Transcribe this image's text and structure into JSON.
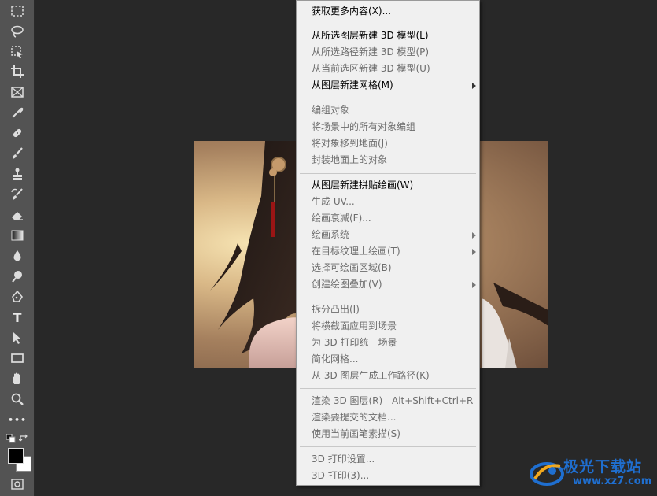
{
  "menu": {
    "items": [
      {
        "label": "获取更多内容(X)...",
        "enabled": true
      },
      {
        "label": "从所选图层新建 3D 模型(L)",
        "enabled": true
      },
      {
        "label": "从所选路径新建 3D 模型(P)",
        "enabled": false
      },
      {
        "label": "从当前选区新建 3D 模型(U)",
        "enabled": false
      },
      {
        "label": "从图层新建网格(M)",
        "enabled": true,
        "submenu": true
      },
      {
        "label": "编组对象",
        "enabled": false
      },
      {
        "label": "将场景中的所有对象编组",
        "enabled": false
      },
      {
        "label": "将对象移到地面(J)",
        "enabled": false
      },
      {
        "label": "封装地面上的对象",
        "enabled": false
      },
      {
        "label": "从图层新建拼贴绘画(W)",
        "enabled": true
      },
      {
        "label": "生成 UV...",
        "enabled": false
      },
      {
        "label": "绘画衰减(F)...",
        "enabled": false
      },
      {
        "label": "绘画系统",
        "enabled": false,
        "submenu": true
      },
      {
        "label": "在目标纹理上绘画(T)",
        "enabled": false,
        "submenu": true
      },
      {
        "label": "选择可绘画区域(B)",
        "enabled": false
      },
      {
        "label": "创建绘图叠加(V)",
        "enabled": false,
        "submenu": true
      },
      {
        "label": "拆分凸出(I)",
        "enabled": false
      },
      {
        "label": "将横截面应用到场景",
        "enabled": false
      },
      {
        "label": "为 3D 打印统一场景",
        "enabled": false
      },
      {
        "label": "简化网格...",
        "enabled": false
      },
      {
        "label": "从 3D 图层生成工作路径(K)",
        "enabled": false
      },
      {
        "label": "渲染 3D 图层(R)",
        "enabled": false,
        "shortcut": "Alt+Shift+Ctrl+R"
      },
      {
        "label": "渲染要提交的文档...",
        "enabled": false
      },
      {
        "label": "使用当前画笔素描(S)",
        "enabled": false
      },
      {
        "label": "3D 打印设置...",
        "enabled": false
      },
      {
        "label": "3D 打印(3)...",
        "enabled": false
      }
    ]
  },
  "toolbar": {
    "tools": [
      "marquee-icon",
      "lasso-icon",
      "object-select-icon",
      "crop-icon",
      "frame-icon",
      "eyedropper-icon",
      "healing-brush-icon",
      "brush-icon",
      "clone-stamp-icon",
      "history-brush-icon",
      "eraser-icon",
      "gradient-icon",
      "blur-icon",
      "dodge-icon",
      "pen-icon",
      "type-icon",
      "path-select-icon",
      "rectangle-icon",
      "hand-icon",
      "zoom-icon",
      "more-tools-icon"
    ],
    "type_glyph": "T",
    "more_glyph": "•••",
    "foreground_color": "#000000",
    "background_color": "#ffffff"
  },
  "watermark": {
    "title": "极光下载站",
    "url": "www.xz7.com",
    "color": "#1f6fd0"
  }
}
